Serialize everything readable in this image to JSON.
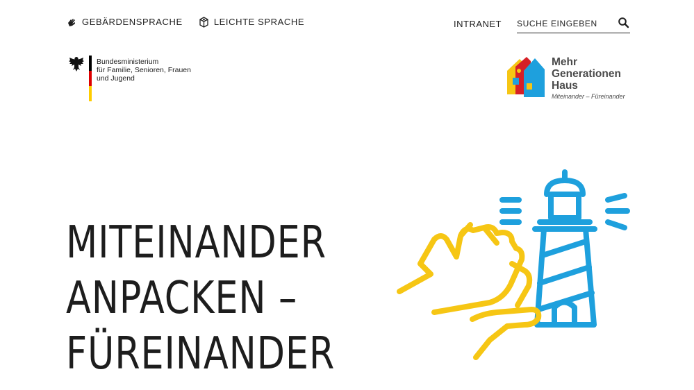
{
  "topnav": {
    "sign_language": "GEBÄRDENSPRACHE",
    "easy_language": "LEICHTE SPRACHE",
    "intranet": "INTRANET",
    "search_placeholder": "SUCHE EINGEBEN"
  },
  "ministry": {
    "lines": [
      "Bundesministerium",
      "für Familie, Senioren, Frauen",
      "und Jugend"
    ]
  },
  "mgh_logo": {
    "line1": "Mehr",
    "line2": "Generationen",
    "line3": "Haus",
    "tagline": "Miteinander – Füreinander"
  },
  "hero": {
    "lines": [
      "MITEINANDER",
      "ANPACKEN –",
      "FÜREINANDER"
    ]
  },
  "colors": {
    "yellow": "#f6c614",
    "blue": "#1ea0dd",
    "red": "#d62027",
    "flag_black": "#000000",
    "flag_red": "#dd0000",
    "flag_gold": "#ffcc00"
  },
  "icons": [
    "sign-language-icon",
    "easy-language-icon",
    "search-icon",
    "federal-eagle-icon",
    "mgh-house-icon",
    "hands-lighthouse-illustration"
  ]
}
